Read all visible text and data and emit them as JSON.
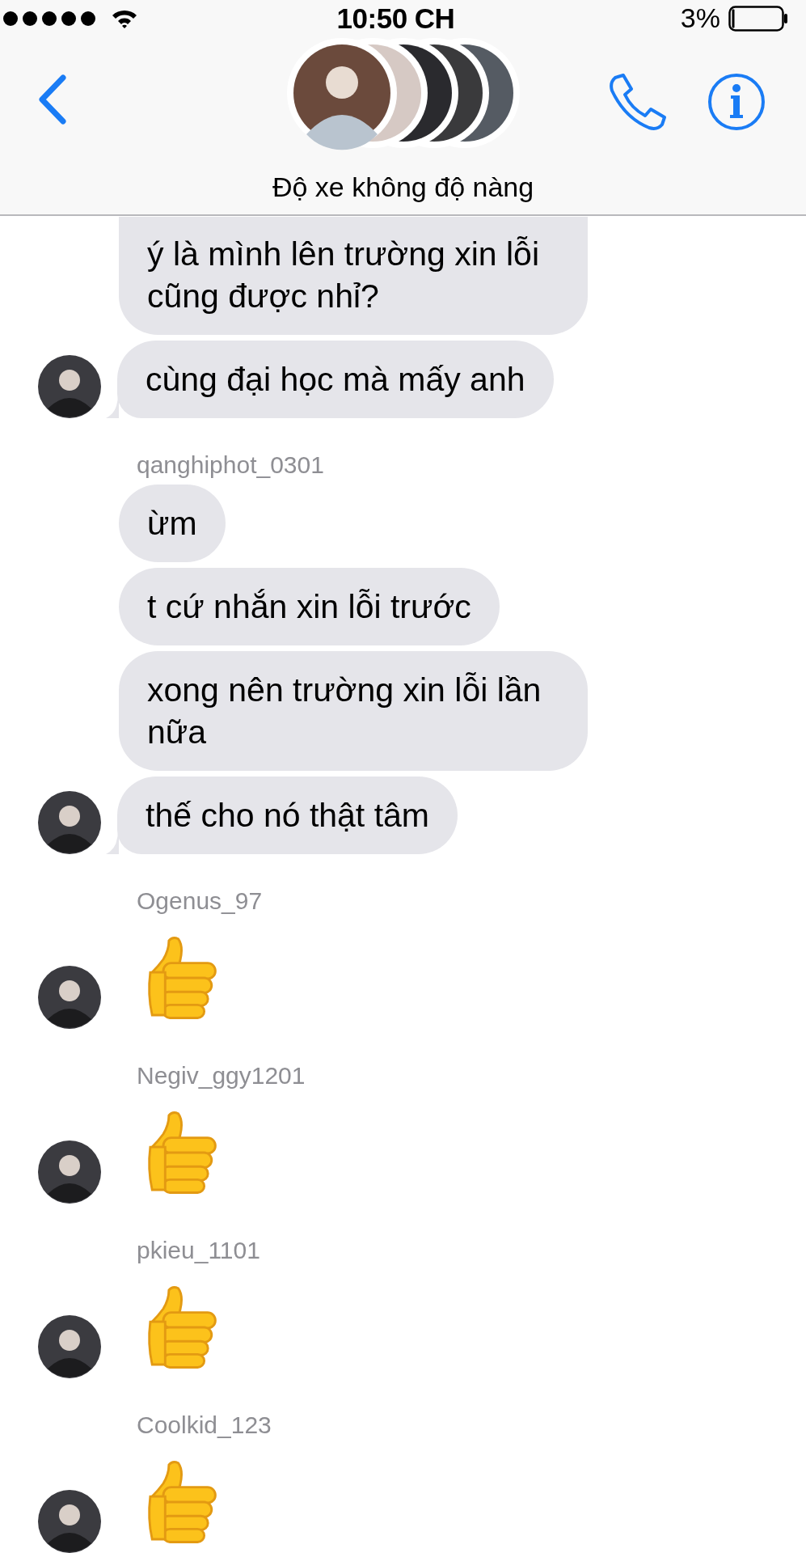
{
  "status_bar": {
    "time": "10:50 CH",
    "battery": "3%"
  },
  "header": {
    "title": "Độ xe không độ nàng"
  },
  "groups": [
    {
      "messages": [
        {
          "kind": "text",
          "text": "ý là mình lên trường xin lỗi cũng được nhỉ?",
          "avatar": false
        },
        {
          "kind": "text",
          "text": "cùng đại học mà mấy anh",
          "avatar": true
        }
      ]
    },
    {
      "sender": "qanghiphot_0301",
      "messages": [
        {
          "kind": "text",
          "text": "ừm",
          "avatar": false
        },
        {
          "kind": "text",
          "text": "t cứ nhắn xin lỗi trước",
          "avatar": false
        },
        {
          "kind": "text",
          "text": "xong nên trường xin lỗi lần nữa",
          "avatar": false
        },
        {
          "kind": "text",
          "text": "thế cho nó thật tâm",
          "avatar": true
        }
      ]
    },
    {
      "sender": "Ogenus_97",
      "messages": [
        {
          "kind": "like",
          "avatar": true
        }
      ]
    },
    {
      "sender": "Negiv_ggy1201",
      "messages": [
        {
          "kind": "like",
          "avatar": true
        }
      ]
    },
    {
      "sender": "pkieu_1101",
      "messages": [
        {
          "kind": "like",
          "avatar": true
        }
      ]
    },
    {
      "sender": "Coolkid_123",
      "messages": [
        {
          "kind": "like",
          "avatar": true
        }
      ]
    }
  ]
}
